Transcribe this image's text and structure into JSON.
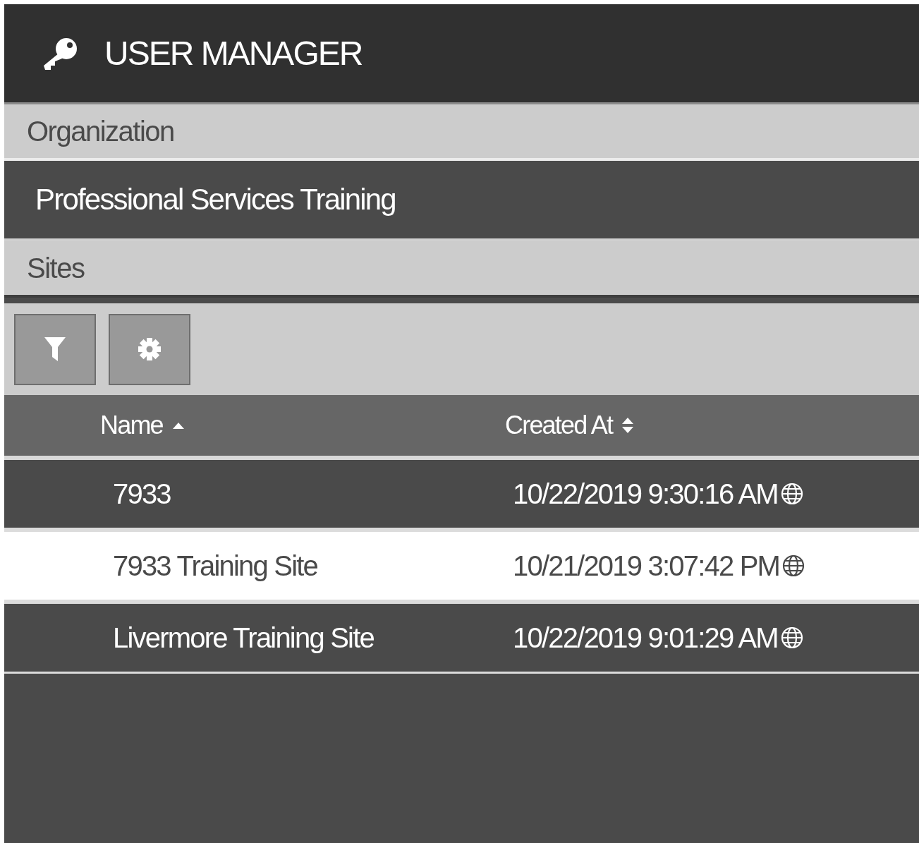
{
  "header": {
    "title": "USER MANAGER"
  },
  "organization": {
    "label": "Organization",
    "value": "Professional Services Training"
  },
  "sites": {
    "label": "Sites"
  },
  "toolbar": {
    "buttons": [
      {
        "kind": "filter"
      },
      {
        "kind": "settings"
      }
    ]
  },
  "table": {
    "columns": [
      {
        "label": "Name",
        "sorted": true,
        "ascending": true
      },
      {
        "label": "Created At",
        "sorted": false
      }
    ],
    "rows": [
      {
        "name": "7933",
        "created_at": "10/22/2019 9:30:16 AM",
        "selected": false
      },
      {
        "name": "7933 Training Site",
        "created_at": "10/21/2019 3:07:42 PM",
        "selected": true
      },
      {
        "name": "Livermore Training Site",
        "created_at": "10/22/2019 9:01:29 AM",
        "selected": false
      }
    ]
  }
}
